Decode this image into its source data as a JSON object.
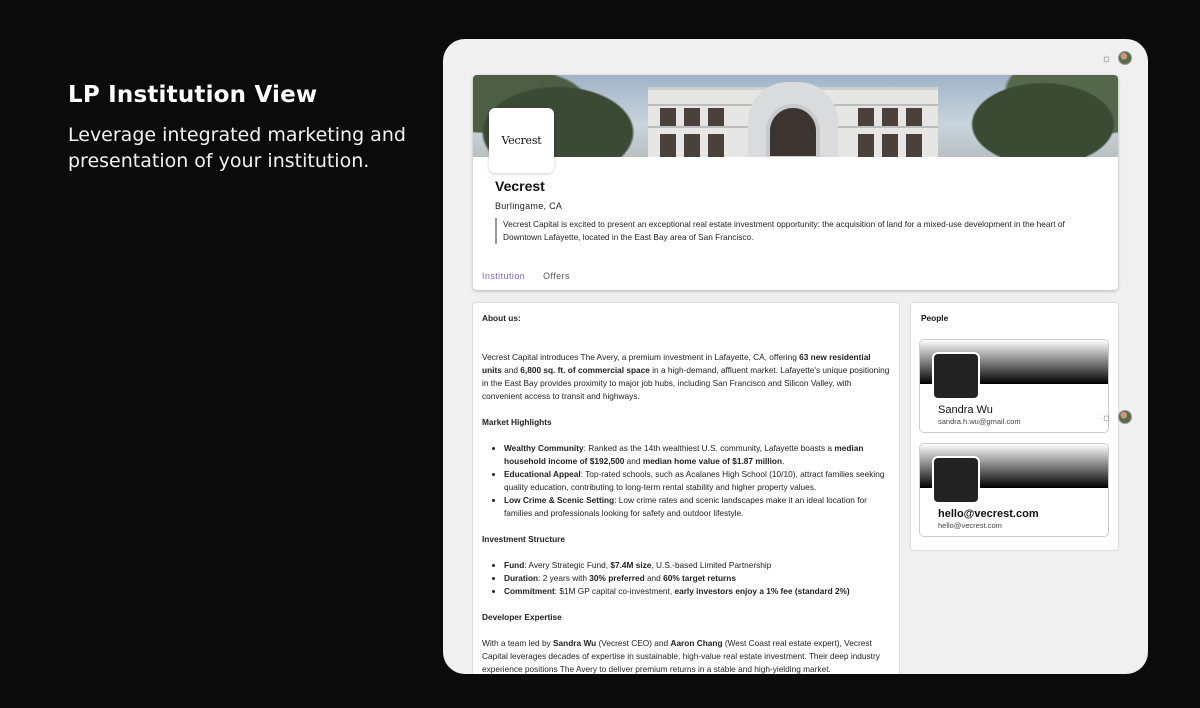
{
  "hero": {
    "title": "LP Institution View",
    "subtitle": "Leverage integrated marketing and presentation of your institution."
  },
  "institution": {
    "logo_text": "Vecrest",
    "name": "Vecrest",
    "location": "Burlingame, CA",
    "description": "Vecrest Capital is excited to present an exceptional real estate investment opportunity: the acquisition of land for a mixed-use development in the heart of Downtown Lafayette, located in the East Bay area of San Francisco."
  },
  "tabs": [
    {
      "label": "Institution",
      "active": true
    },
    {
      "label": "Offers",
      "active": false
    }
  ],
  "about": {
    "heading": "About us:",
    "intro": {
      "t1": "Vecrest Capital introduces The Avery, a premium investment in Lafayette, CA, offering ",
      "b1": "63 new residential units",
      "t2": " and ",
      "b2": "6,800 sq. ft. of commercial space",
      "t3": " in a high-demand, affluent market. Lafayette's unique positioning in the East Bay provides proximity to major job hubs, including San Francisco and Silicon Valley, with convenient access to transit and highways."
    },
    "market_heading": "Market Highlights",
    "market": [
      {
        "b": "Wealthy Community",
        "t1": ": Ranked as the 14th wealthiest U.S. community, Lafayette boasts a ",
        "b2": "median household income of $192,500",
        "t2": " and ",
        "b3": "median home value of $1.87 million",
        "t3": "."
      },
      {
        "b": "Educational Appeal",
        "t1": ": Top-rated schools, such as Acalanes High School (10/10), attract families seeking quality education, contributing to long-term rental stability and higher property values."
      },
      {
        "b": "Low Crime & Scenic Setting",
        "t1": ": Low crime rates and scenic landscapes make it an ideal location for families and professionals looking for safety and outdoor lifestyle."
      }
    ],
    "investment_heading": "Investment Structure",
    "investment": [
      {
        "b": "Fund",
        "t1": ": Avery Strategic Fund, ",
        "b2": "$7.4M size",
        "t2": ", U.S.-based Limited Partnership"
      },
      {
        "b": "Duration",
        "t1": ": 2 years with ",
        "b2": "30% preferred",
        "t2": " and ",
        "b3": "60% target returns"
      },
      {
        "b": "Commitment",
        "t1": ": $1M GP capital co-investment, ",
        "b2": "early investors enjoy a 1% fee (standard 2%)"
      }
    ],
    "developer_heading": "Developer Expertise",
    "developer": {
      "t1": "With a team led by ",
      "b1": "Sandra Wu",
      "t2": " (Vecrest CEO) and ",
      "b2": "Aaron Chang",
      "t3": " (West Coast real estate expert), Vecrest Capital leverages decades of expertise in sustainable, high-value real estate investment. Their deep industry experience positions The Avery to deliver premium returns in a stable and high-yielding market."
    }
  },
  "people": {
    "title": "People",
    "items": [
      {
        "name": "Sandra Wu",
        "email": "sandra.h.wu@gmail.com"
      },
      {
        "name": "hello@vecrest.com",
        "email": "hello@vecrest.com"
      }
    ]
  },
  "icons": {
    "theme": "sun-icon",
    "user": "avatar"
  },
  "colors": {
    "accent": "#7a62b8",
    "page_bg": "#0b0b0b",
    "app_bg": "#f0f0f0"
  }
}
